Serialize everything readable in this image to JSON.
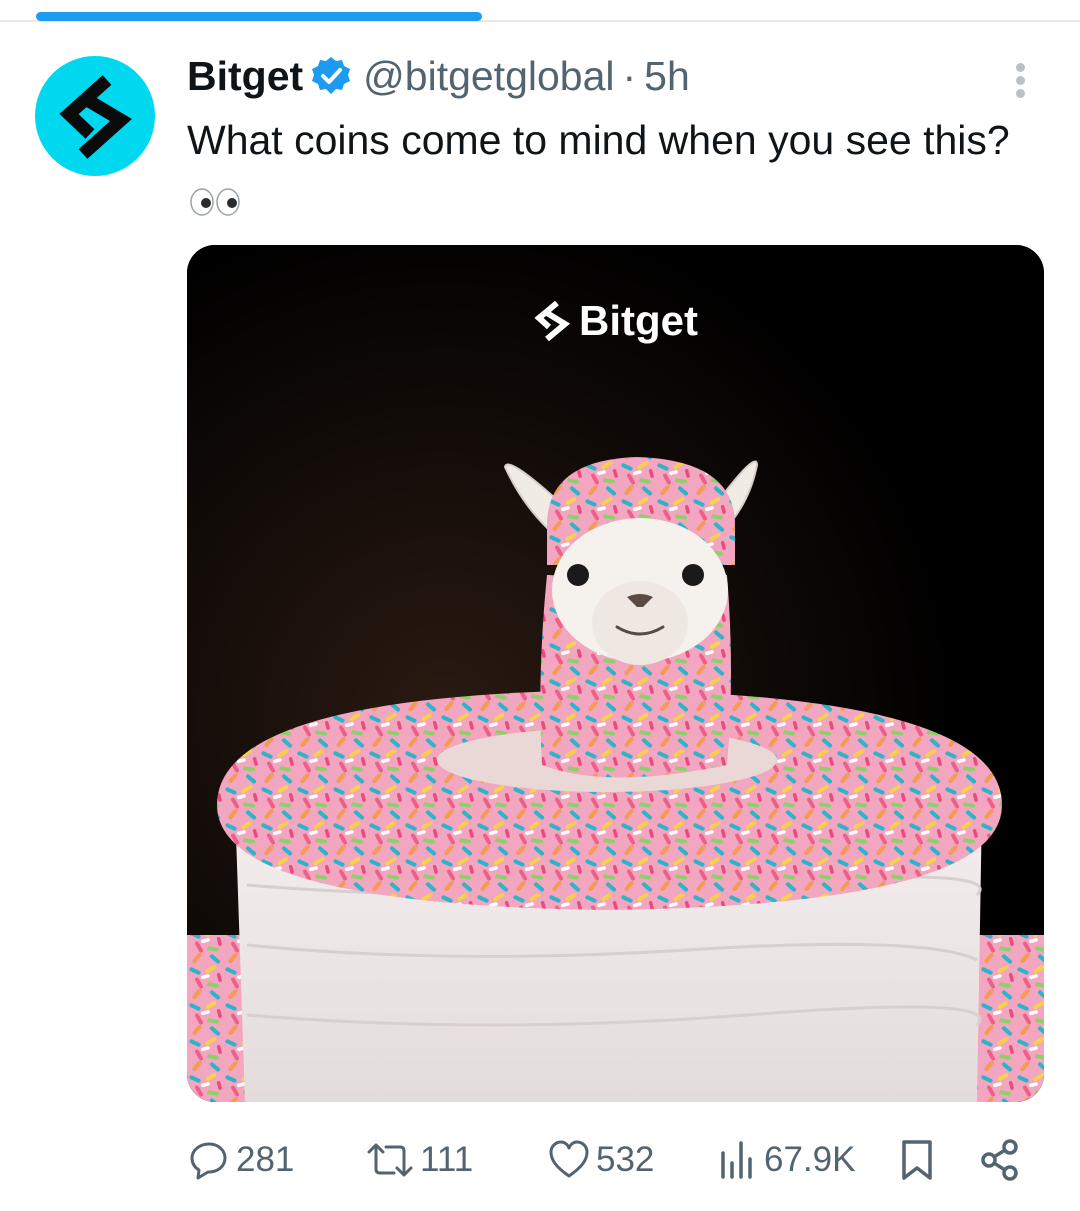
{
  "progress": {
    "fraction": 0.41,
    "color": "#1d9bf0"
  },
  "post": {
    "author": {
      "display_name": "Bitget",
      "handle": "@bitgetglobal",
      "verified": true,
      "avatar_icon": "bitget-logo-icon",
      "avatar_color": "#00d8f0"
    },
    "separator": "·",
    "time": "5h",
    "text": "What coins come to mind when you see this?",
    "text_emoji": "eyes-emoji",
    "media": {
      "watermark_icon": "bitget-logo-icon",
      "watermark_text": "Bitget",
      "subject": "llama-sprinkle-cake-image"
    },
    "actions": {
      "replies": "281",
      "reposts": "111",
      "likes": "532",
      "views": "67.9K",
      "bookmark_icon": "bookmark-icon",
      "share_icon": "share-icon"
    }
  },
  "colors": {
    "verified": "#1d9bf0",
    "secondary_text": "#536471",
    "primary_text": "#0f1419"
  }
}
